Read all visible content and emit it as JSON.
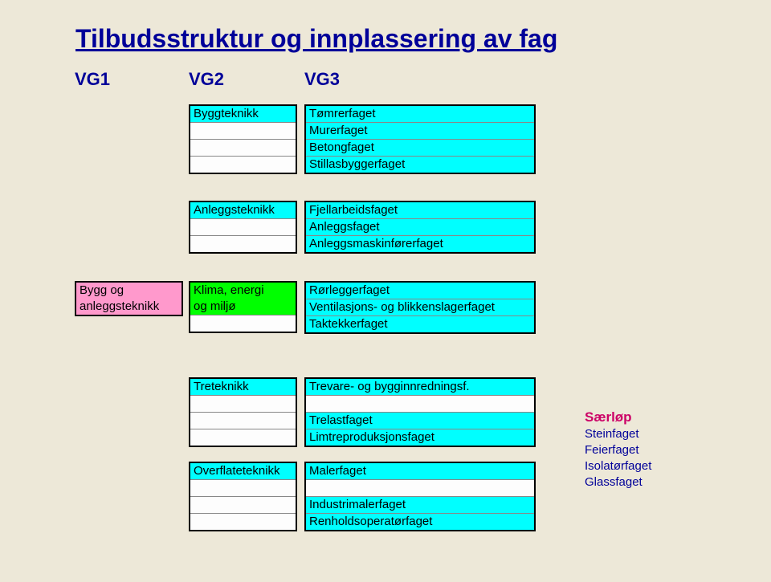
{
  "title": "Tilbudsstruktur og innplassering av fag",
  "headers": {
    "vg1": "VG1",
    "vg2": "VG2",
    "vg3": "VG3"
  },
  "byggteknikk": {
    "label": "Byggteknikk",
    "items": [
      "Tømrerfaget",
      "Murerfaget",
      "Betongfaget",
      "Stillasbyggerfaget"
    ]
  },
  "anleggsteknikk": {
    "label": "Anleggsteknikk",
    "items": [
      "Fjellarbeidsfaget",
      "Anleggsfaget",
      "Anleggsmaskinførerfaget"
    ]
  },
  "bygg_anlegg": {
    "line1": "Bygg og",
    "line2": "anleggsteknikk"
  },
  "klima": {
    "line1": "Klima, energi",
    "line2": "og miljø",
    "items": [
      "Rørleggerfaget",
      "Ventilasjons- og blikkenslagerfaget",
      "Taktekkerfaget"
    ]
  },
  "treteknikk": {
    "label": "Treteknikk",
    "items": [
      "Trevare- og bygginnredningsf.",
      "",
      "Trelastfaget",
      "Limtreproduksjonsfaget"
    ]
  },
  "overflateteknikk": {
    "label": "Overflateteknikk",
    "items": [
      "Malerfaget",
      "",
      "Industrimalerfaget",
      "Renholdsoperatørfaget"
    ]
  },
  "sidelabels": {
    "heading": "Særløp",
    "items": [
      "Steinfaget",
      "Feierfaget",
      "Isolatørfaget",
      "Glassfaget"
    ]
  }
}
